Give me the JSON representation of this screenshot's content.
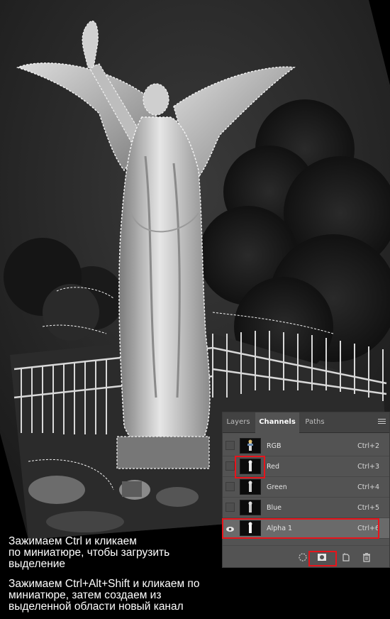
{
  "panel": {
    "tabs": [
      "Layers",
      "Channels",
      "Paths"
    ],
    "active_tab": "Channels",
    "channels": [
      {
        "name": "RGB",
        "shortcut": "Ctrl+2",
        "visible": false,
        "selected": false
      },
      {
        "name": "Red",
        "shortcut": "Ctrl+3",
        "visible": false,
        "selected": false
      },
      {
        "name": "Green",
        "shortcut": "Ctrl+4",
        "visible": false,
        "selected": false
      },
      {
        "name": "Blue",
        "shortcut": "Ctrl+5",
        "visible": false,
        "selected": false
      },
      {
        "name": "Alpha 1",
        "shortcut": "Ctrl+6",
        "visible": true,
        "selected": true
      }
    ],
    "bottom_icons": [
      "load-selection-icon",
      "save-selection-as-channel-icon",
      "new-channel-icon",
      "delete-channel-icon"
    ]
  },
  "captions": {
    "first": [
      "Зажимаем Ctrl и кликаем",
      "по миниатюре, чтобы загрузить",
      "выделение"
    ],
    "second": [
      "Зажимаем Ctrl+Alt+Shift и кликаем по",
      "миниатюре, затем создаем из",
      "выделенной области новый канал"
    ]
  },
  "colors": {
    "highlight": "#e8141b",
    "panel_bg": "#535353",
    "selected_row": "#6a6a6a"
  }
}
